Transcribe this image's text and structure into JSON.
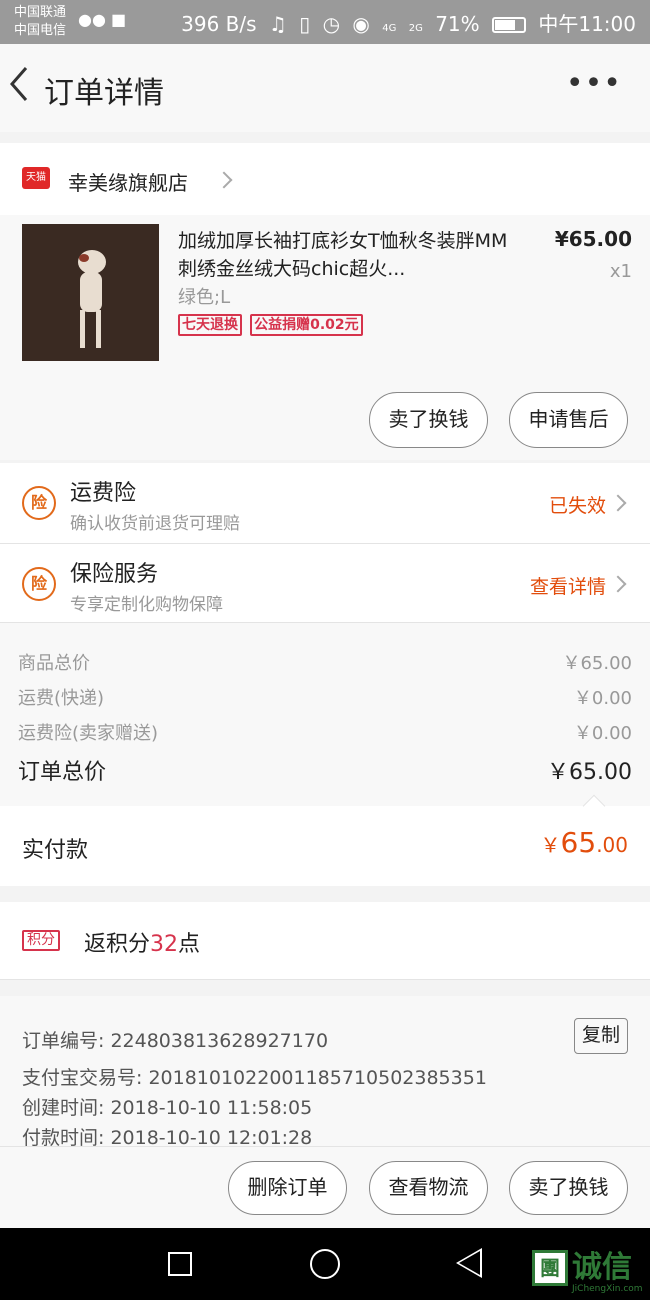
{
  "status_bar": {
    "carrier1": "中国联通",
    "carrier2": "中国电信",
    "speed": "396 B/s",
    "net1": "4G",
    "net2": "2G",
    "battery": "71%",
    "time": "中午11:00"
  },
  "header": {
    "title": "订单详情",
    "more": "•••"
  },
  "store": {
    "badge": "天猫",
    "name": "幸美缘旗舰店"
  },
  "product": {
    "name": "加绒加厚长袖打底衫女T恤秋冬装胖MM刺绣金丝绒大码chic超火...",
    "variant": "绿色;L",
    "tags": [
      "七天退换",
      "公益捐赠0.02元"
    ],
    "price": "¥65.00",
    "qty": "x1",
    "buttons": [
      "卖了换钱",
      "申请售后"
    ]
  },
  "insurance": [
    {
      "badge": "险",
      "title": "运费险",
      "subtitle": "确认收货前退货可理赔",
      "status": "已失效"
    },
    {
      "badge": "险",
      "title": "保险服务",
      "subtitle": "专享定制化购物保障",
      "status": "查看详情"
    }
  ],
  "totals": {
    "rows": [
      {
        "label": "商品总价",
        "value": "￥65.00"
      },
      {
        "label": "运费(快递)",
        "value": "￥0.00"
      },
      {
        "label": "运费险(卖家赠送)",
        "value": "￥0.00"
      }
    ],
    "total_label": "订单总价",
    "total_value": "￥65.00"
  },
  "paid": {
    "label": "实付款",
    "currency": "￥",
    "int": "65",
    "dec": ".00"
  },
  "points": {
    "tag": "积分",
    "prefix": "返积分",
    "num": "32",
    "suffix": "点"
  },
  "info": {
    "order_no": "订单编号: 224803813628927170",
    "alipay_no": "支付宝交易号: 2018101022001185710502385351",
    "created": "创建时间: 2018-10-10 11:58:05",
    "paid_time": "付款时间: 2018-10-10 12:01:28",
    "copy": "复制"
  },
  "bottom_buttons": [
    "删除订单",
    "查看物流",
    "卖了换钱"
  ],
  "watermark": {
    "box": "團",
    "text": "诚信",
    "sub": "JiChengXin.com"
  },
  "colors": {
    "accent": "#e24d0c",
    "tag_red": "#d6334c",
    "tmall_red": "#e02828"
  }
}
